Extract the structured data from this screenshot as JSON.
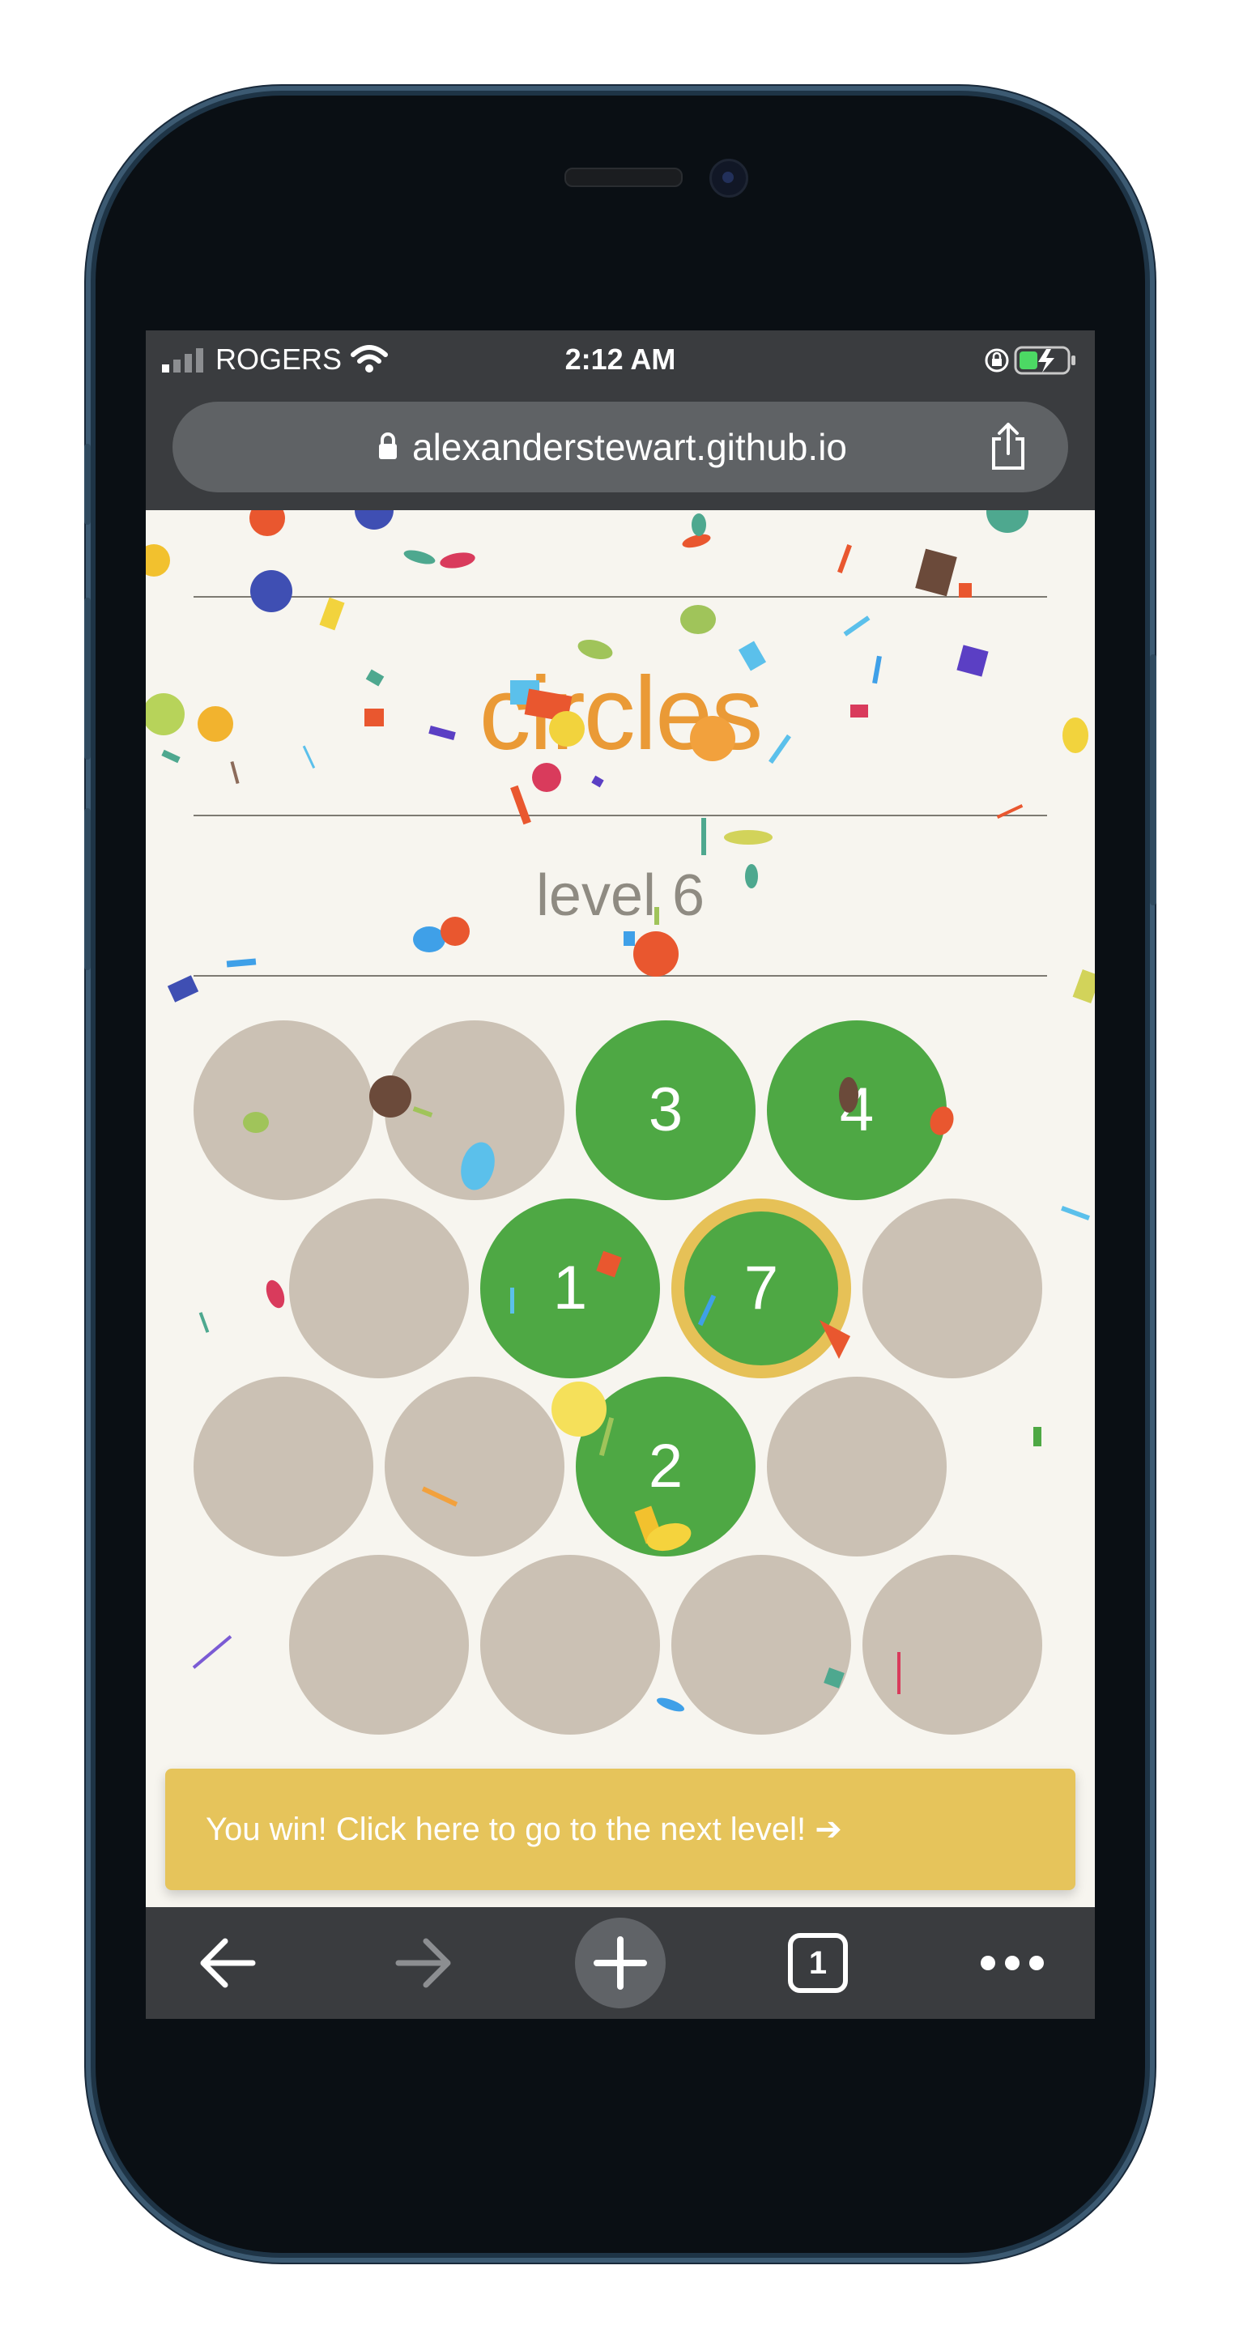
{
  "status_bar": {
    "carrier": "ROGERS",
    "time": "2:12 AM"
  },
  "browser": {
    "url": "alexanderstewart.github.io",
    "tab_count": "1"
  },
  "page": {
    "title": "circles",
    "level": "level 6",
    "win_message": "You win! Click here to go to the next level! ➔"
  },
  "board": {
    "rows": [
      [
        {
          "value": "",
          "state": "empty"
        },
        {
          "value": "",
          "state": "empty"
        },
        {
          "value": "3",
          "state": "filled"
        },
        {
          "value": "4",
          "state": "filled"
        }
      ],
      [
        {
          "value": "",
          "state": "empty"
        },
        {
          "value": "1",
          "state": "filled"
        },
        {
          "value": "7",
          "state": "selected"
        },
        {
          "value": "",
          "state": "empty"
        }
      ],
      [
        {
          "value": "",
          "state": "empty"
        },
        {
          "value": "",
          "state": "empty"
        },
        {
          "value": "2",
          "state": "filled"
        },
        {
          "value": "",
          "state": "empty"
        }
      ],
      [
        {
          "value": "",
          "state": "empty"
        },
        {
          "value": "",
          "state": "empty"
        },
        {
          "value": "",
          "state": "empty"
        },
        {
          "value": "",
          "state": "empty"
        }
      ]
    ]
  },
  "colors": {
    "title": "#ea9a36",
    "filled_circle": "#4ea844",
    "empty_circle": "#cbc1b4",
    "selected_ring": "#e6c157",
    "banner": "#e6c45b",
    "background": "#f7f5ef"
  },
  "icons": {
    "lock": "lock-icon",
    "share": "share-icon",
    "back": "back-arrow-icon",
    "forward": "forward-arrow-icon",
    "new_tab": "plus-icon",
    "tabs": "tab-switcher-icon",
    "menu": "more-dots-icon"
  }
}
